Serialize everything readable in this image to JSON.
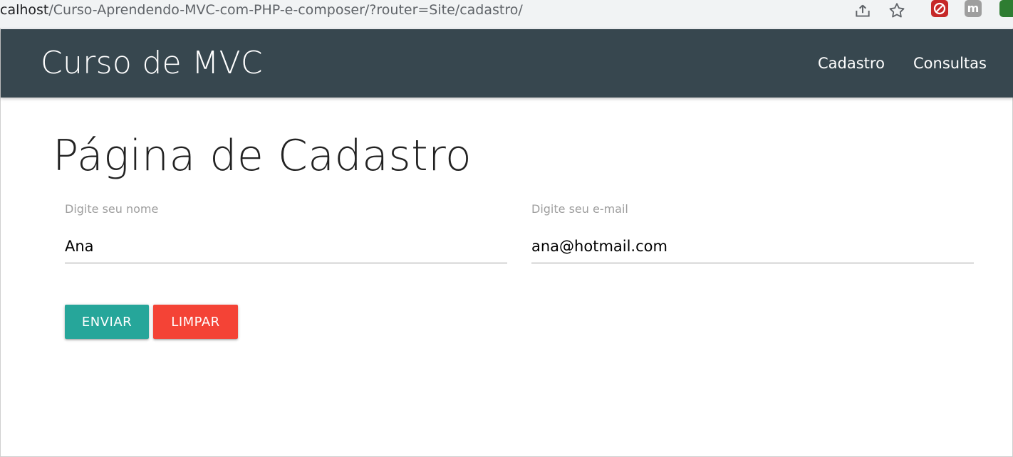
{
  "browser": {
    "url_host": "calhost",
    "url_path": "/Curso-Aprendendo-MVC-com-PHP-e-composer/?router=Site/cadastro/",
    "ext_gray_label": "m"
  },
  "navbar": {
    "brand": "Curso de MVC",
    "links": [
      {
        "label": "Cadastro"
      },
      {
        "label": "Consultas"
      }
    ],
    "color": "#37474f"
  },
  "main": {
    "title": "Página de Cadastro",
    "form": {
      "name": {
        "label": "Digite seu nome",
        "value": "Ana"
      },
      "email": {
        "label": "Digite seu e-mail",
        "value": "ana@hotmail.com"
      }
    },
    "buttons": {
      "send_label": "Enviar",
      "clear_label": "Limpar",
      "send_color": "#26a69a",
      "clear_color": "#f44336"
    }
  }
}
